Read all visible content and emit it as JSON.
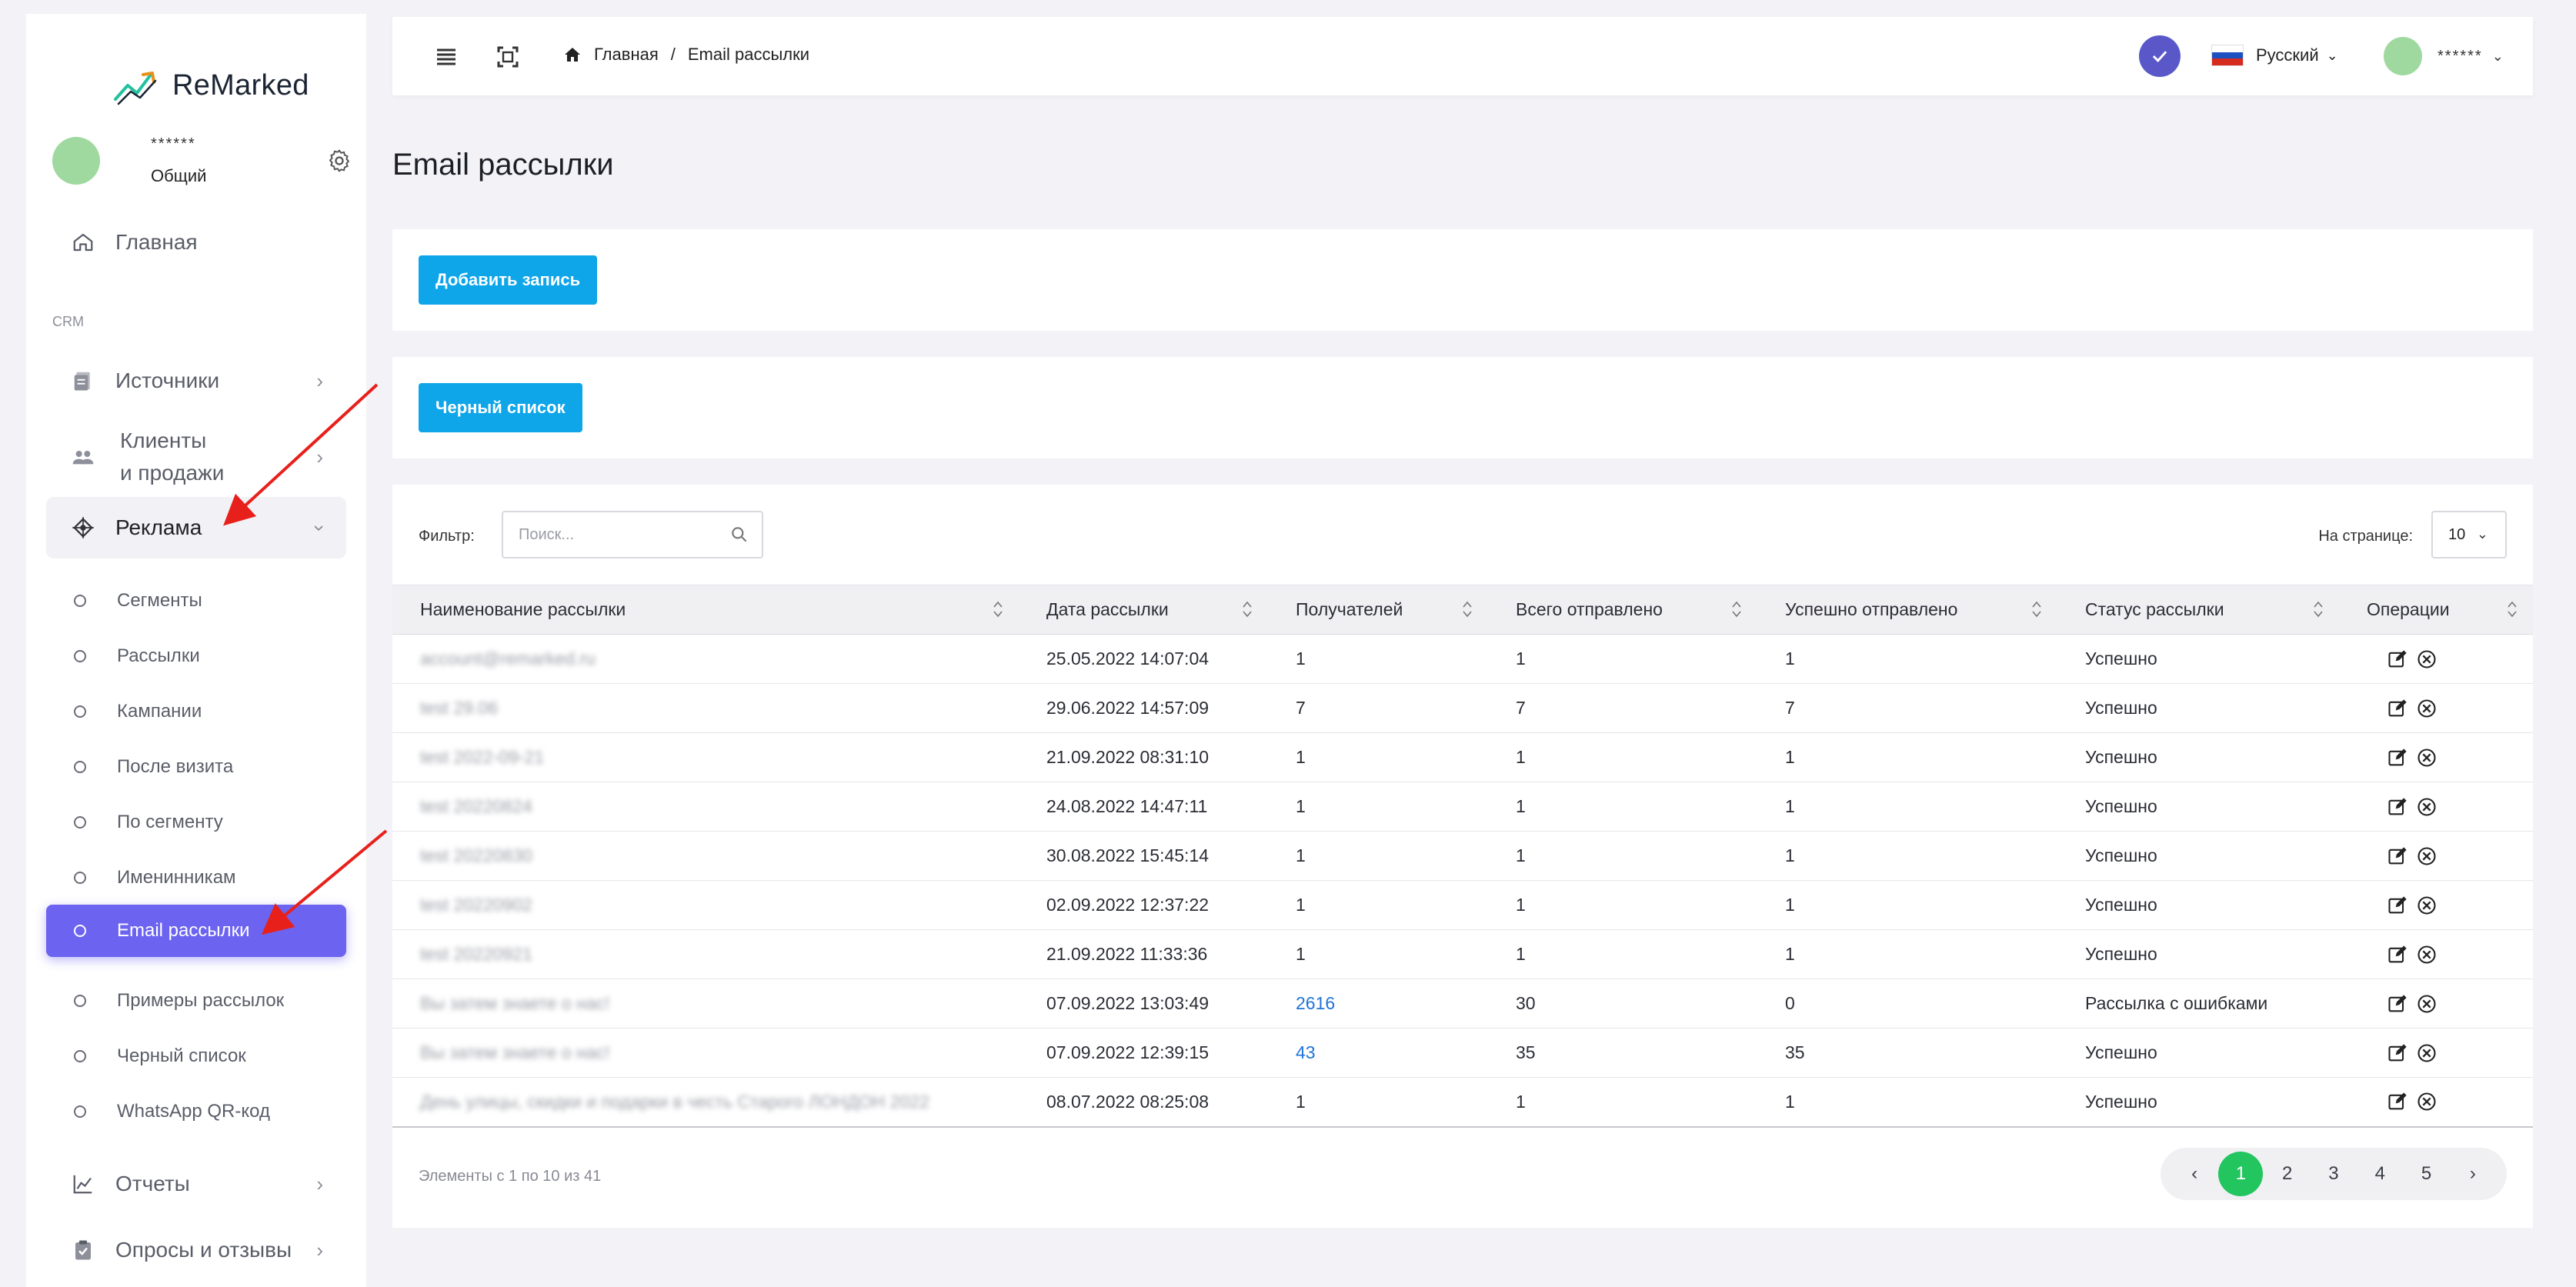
{
  "app": {
    "name": "ReMarked"
  },
  "user": {
    "name": "******",
    "role": "Общий"
  },
  "sidebar": {
    "home_label": "Главная",
    "section_label": "CRM",
    "items": [
      {
        "label": "Источники"
      },
      {
        "label": "Клиенты",
        "label2": "и продажи"
      },
      {
        "label": "Реклама"
      },
      {
        "label": "Отчеты"
      },
      {
        "label": "Опросы и отзывы"
      }
    ],
    "sub_items": [
      "Сегменты",
      "Рассылки",
      "Кампании",
      "После визита",
      "По сегменту",
      "Именинникам",
      "Email рассылки",
      "Примеры рассылок",
      "Черный список",
      "WhatsApp QR-код"
    ]
  },
  "topbar": {
    "breadcrumb_home": "Главная",
    "breadcrumb_sep": "/",
    "breadcrumb_current": "Email рассылки",
    "language": "Русский",
    "user": "******"
  },
  "page": {
    "title": "Email рассылки",
    "add_button": "Добавить запись",
    "blacklist_button": "Черный список",
    "filter_label": "Фильтр:",
    "search_placeholder": "Поиск...",
    "per_page_label": "На странице:",
    "per_page_value": "10"
  },
  "table": {
    "columns": [
      "Наименование рассылки",
      "Дата рассылки",
      "Получателей",
      "Всего отправлено",
      "Успешно отправлено",
      "Статус рассылки",
      "Операции"
    ],
    "rows": [
      {
        "name": "account@remarked.ru",
        "date": "25.05.2022 14:07:04",
        "recipients": "1",
        "sent": "1",
        "success": "1",
        "status": "Успешно"
      },
      {
        "name": "test 29.06",
        "date": "29.06.2022 14:57:09",
        "recipients": "7",
        "sent": "7",
        "success": "7",
        "status": "Успешно"
      },
      {
        "name": "test 2022-09-21",
        "date": "21.09.2022 08:31:10",
        "recipients": "1",
        "sent": "1",
        "success": "1",
        "status": "Успешно"
      },
      {
        "name": "test 20220824",
        "date": "24.08.2022 14:47:11",
        "recipients": "1",
        "sent": "1",
        "success": "1",
        "status": "Успешно"
      },
      {
        "name": "test 20220830",
        "date": "30.08.2022 15:45:14",
        "recipients": "1",
        "sent": "1",
        "success": "1",
        "status": "Успешно"
      },
      {
        "name": "test 20220902",
        "date": "02.09.2022 12:37:22",
        "recipients": "1",
        "sent": "1",
        "success": "1",
        "status": "Успешно"
      },
      {
        "name": "test 20220921",
        "date": "21.09.2022 11:33:36",
        "recipients": "1",
        "sent": "1",
        "success": "1",
        "status": "Успешно"
      },
      {
        "name": "Вы затем знаете о нас!",
        "date": "07.09.2022 13:03:49",
        "recipients": "2616",
        "sent": "30",
        "success": "0",
        "status": "Рассылка с ошибками",
        "link": true
      },
      {
        "name": "Вы затем знаете о нас!",
        "date": "07.09.2022 12:39:15",
        "recipients": "43",
        "sent": "35",
        "success": "35",
        "status": "Успешно",
        "link": true
      },
      {
        "name": "День улицы, скидки и подарки в честь Старого ЛОНДОН 2022",
        "date": "08.07.2022 08:25:08",
        "recipients": "1",
        "sent": "1",
        "success": "1",
        "status": "Успешно"
      }
    ],
    "info": "Элементы с 1 по 10 из 41"
  },
  "pagination": {
    "prev": "‹",
    "next": "›",
    "pages": [
      "1",
      "2",
      "3",
      "4",
      "5"
    ],
    "current": "1"
  },
  "colors": {
    "accent": "#6c63f0",
    "button": "#0ea5e9",
    "pager_active": "#22c55e",
    "link": "#1f74d8",
    "annotation": "#e8201c"
  }
}
